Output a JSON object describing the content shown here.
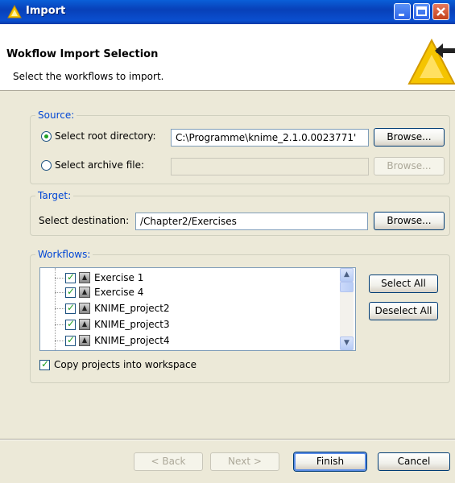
{
  "window": {
    "title": "Import"
  },
  "header": {
    "title": "Wokflow Import Selection",
    "subtitle": "Select the workflows to import."
  },
  "source": {
    "legend": "Source:",
    "root_label": "Select root directory:",
    "root_value": "C:\\Programme\\knime_2.1.0.0023771'",
    "root_browse": "Browse...",
    "archive_label": "Select archive file:",
    "archive_value": "",
    "archive_browse": "Browse...",
    "selected": "root"
  },
  "target": {
    "legend": "Target:",
    "dest_label": "Select destination:",
    "dest_value": "/Chapter2/Exercises",
    "browse": "Browse..."
  },
  "workflows": {
    "legend": "Workflows:",
    "items": [
      {
        "label": "Exercise 1",
        "checked": true
      },
      {
        "label": "Exercise 4",
        "checked": true
      },
      {
        "label": "KNIME_project2",
        "checked": true
      },
      {
        "label": "KNIME_project3",
        "checked": true
      },
      {
        "label": "KNIME_project4",
        "checked": true
      }
    ],
    "select_all": "Select All",
    "deselect_all": "Deselect All",
    "copy_label": "Copy projects into workspace",
    "copy_checked": true
  },
  "footer": {
    "back": "< Back",
    "next": "Next >",
    "finish": "Finish",
    "cancel": "Cancel"
  },
  "colors": {
    "titlebar": "#0a4fd0",
    "legend": "#0046d5",
    "check": "#21a121"
  },
  "icons": {
    "app": "knime-triangle-icon",
    "banner": "import-wizard-icon",
    "workflow": "workflow-project-icon"
  }
}
